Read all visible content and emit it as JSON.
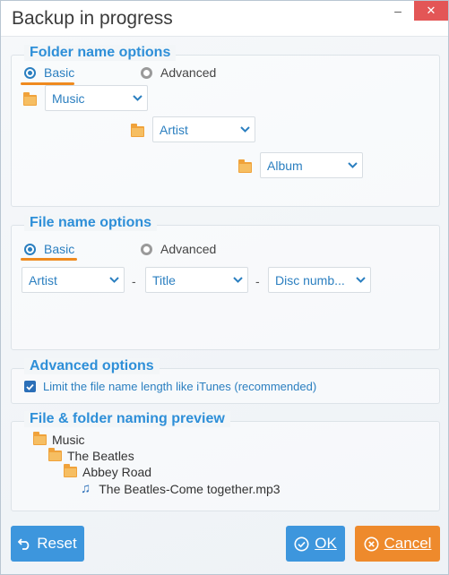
{
  "window": {
    "title": "Backup in progress",
    "minimize_glyph": "–",
    "close_glyph": "✕"
  },
  "folder_options": {
    "title": "Folder name options",
    "radio_basic": "Basic",
    "radio_advanced": "Advanced",
    "selected": "Basic",
    "levels": [
      "Music",
      "Artist",
      "Album"
    ]
  },
  "file_options": {
    "title": "File name options",
    "radio_basic": "Basic",
    "radio_advanced": "Advanced",
    "selected": "Basic",
    "parts": [
      "Artist",
      "Title",
      "Disc numb..."
    ],
    "separator": "-"
  },
  "advanced": {
    "title": "Advanced options",
    "limit_label": "Limit the file name length like iTunes (recommended)",
    "limit_checked": true
  },
  "preview": {
    "title": "File & folder naming preview",
    "folders": [
      "Music",
      "The Beatles",
      "Abbey Road"
    ],
    "file": "The Beatles-Come together.mp3"
  },
  "buttons": {
    "reset": "Reset",
    "ok": "OK",
    "cancel": "Cancel"
  },
  "colors": {
    "accent": "#2e8fd8",
    "orange": "#ef8a1e",
    "close": "#e35656"
  }
}
